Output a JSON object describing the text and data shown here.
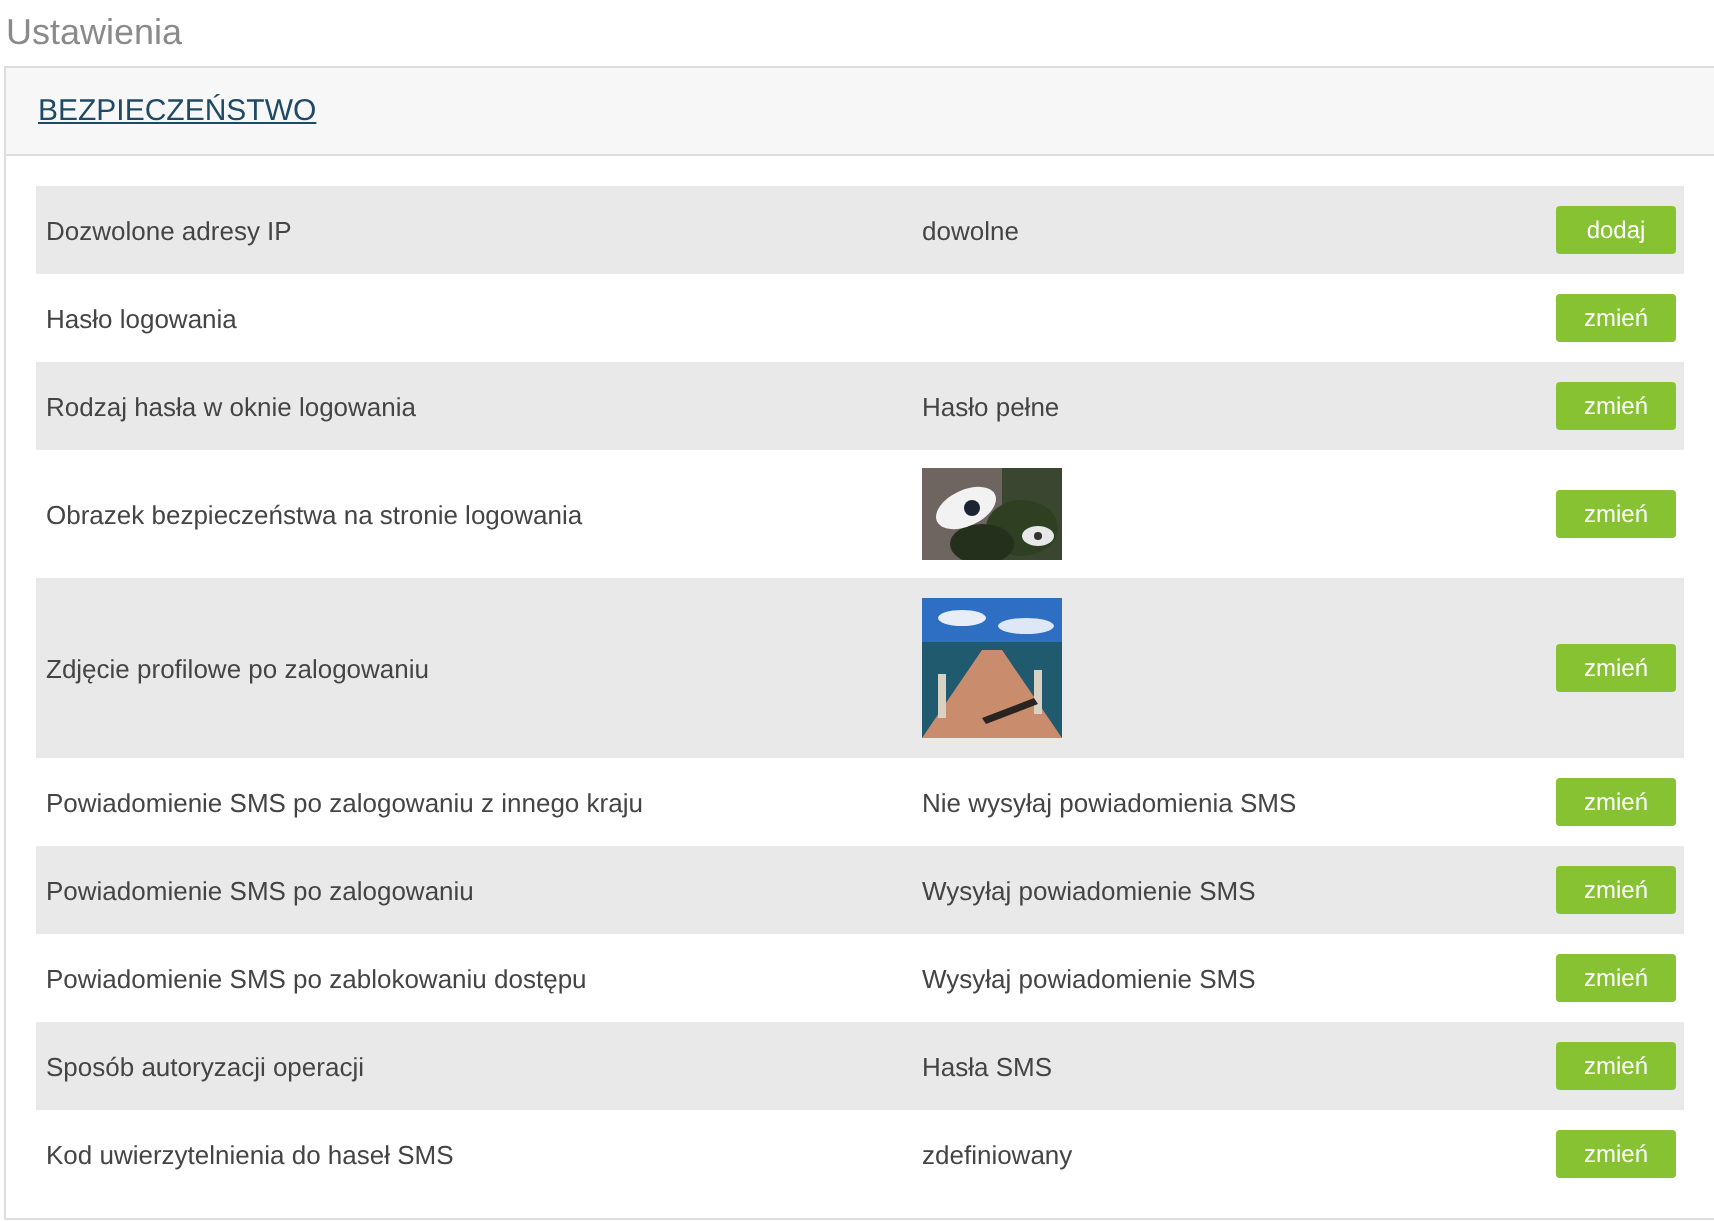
{
  "page": {
    "title": "Ustawienia"
  },
  "section": {
    "title": "BEZPIECZEŃSTWO",
    "rows": [
      {
        "label": "Dozwolone adresy IP",
        "kind": "text",
        "value": "dowolne",
        "button": "dodaj"
      },
      {
        "label": "Hasło logowania",
        "kind": "empty",
        "button": "zmień"
      },
      {
        "label": "Rodzaj hasła w oknie logowania",
        "kind": "text",
        "value": "Hasło pełne",
        "button": "zmień"
      },
      {
        "label": "Obrazek bezpieczeństwa na stronie logowania",
        "kind": "picture",
        "button": "zmień"
      },
      {
        "label": "Zdjęcie profilowe po zalogowaniu",
        "kind": "picture",
        "button": "zmień"
      },
      {
        "label": "Powiadomienie SMS po zalogowaniu z innego kraju",
        "kind": "text",
        "value": "Nie wysyłaj powiadomienia SMS",
        "button": "zmień"
      },
      {
        "label": "Powiadomienie SMS po zalogowaniu",
        "kind": "text",
        "value": "Wysyłaj powiadomienie SMS",
        "button": "zmień"
      },
      {
        "label": "Powiadomienie SMS po zablokowaniu dostępu",
        "kind": "text",
        "value": "Wysyłaj powiadomienie SMS",
        "button": "zmień"
      },
      {
        "label": "Sposób autoryzacji operacji",
        "kind": "text",
        "value": "Hasła SMS",
        "button": "zmień"
      },
      {
        "label": "Kod uwierzytelnienia do haseł SMS",
        "kind": "text",
        "value": "zdefiniowany",
        "button": "zmień"
      }
    ]
  }
}
